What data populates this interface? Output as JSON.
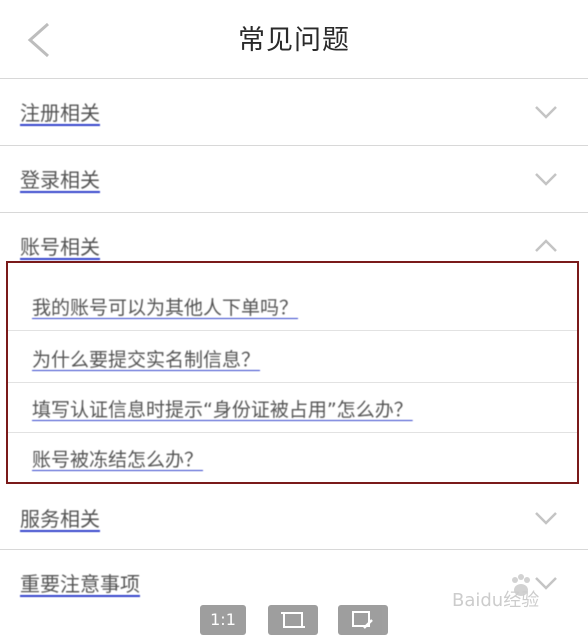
{
  "header": {
    "title": "常见问题",
    "back_icon": "chevron-left-icon"
  },
  "sections": [
    {
      "label": "注册相关",
      "icon": "chevron-down-icon"
    },
    {
      "label": "登录相关",
      "icon": "chevron-down-icon"
    },
    {
      "label": "账号相关",
      "icon": "chevron-up-icon",
      "expanded": true
    },
    {
      "label": "服务相关",
      "icon": "chevron-down-icon"
    },
    {
      "label": "重要注意事项",
      "icon": "chevron-down-icon"
    }
  ],
  "questions": [
    "我的账号可以为其他人下单吗？",
    "为什么要提交实名制信息？",
    "填写认证信息时提示“身份证被占用”怎么办？",
    "账号被冻结怎么办？"
  ],
  "toolbar": {
    "actual_size_label": "1:1",
    "fit_icon": "fit-screen-icon",
    "edit_icon": "edit-image-icon"
  },
  "watermark": {
    "text": "Baidu经验"
  },
  "colors": {
    "highlight_border": "#7a1a1a",
    "link_underline": "#3344cc"
  }
}
